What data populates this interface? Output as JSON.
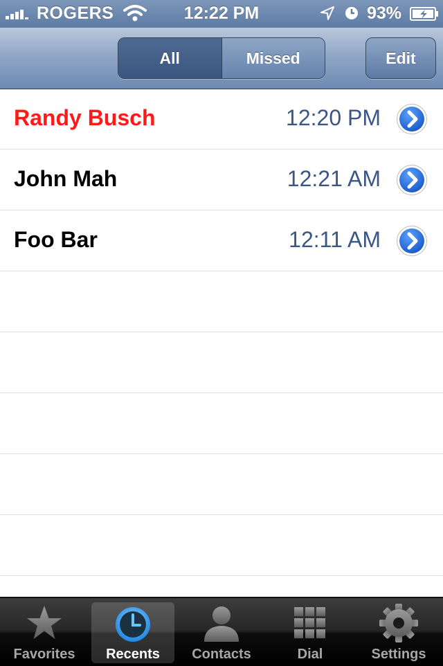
{
  "status": {
    "carrier": "ROGERS",
    "time": "12:22 PM",
    "battery_pct": "93%"
  },
  "nav": {
    "segments": [
      "All",
      "Missed"
    ],
    "selected_segment": "All",
    "edit_label": "Edit"
  },
  "calls": [
    {
      "name": "Randy Busch",
      "time": "12:20 PM",
      "missed": true
    },
    {
      "name": "John Mah",
      "time": "12:21 AM",
      "missed": false
    },
    {
      "name": "Foo Bar",
      "time": "12:11 AM",
      "missed": false
    }
  ],
  "tabs": [
    {
      "label": "Favorites",
      "icon": "star-icon"
    },
    {
      "label": "Recents",
      "icon": "clock-icon",
      "active": true
    },
    {
      "label": "Contacts",
      "icon": "person-icon"
    },
    {
      "label": "Dial",
      "icon": "keypad-icon"
    },
    {
      "label": "Settings",
      "icon": "gear-icon"
    }
  ],
  "colors": {
    "missed_call": "#ff1a1a",
    "time_text": "#3a5684",
    "nav_bar": "#8ea4c4",
    "disclosure": "#1f6fd6"
  }
}
